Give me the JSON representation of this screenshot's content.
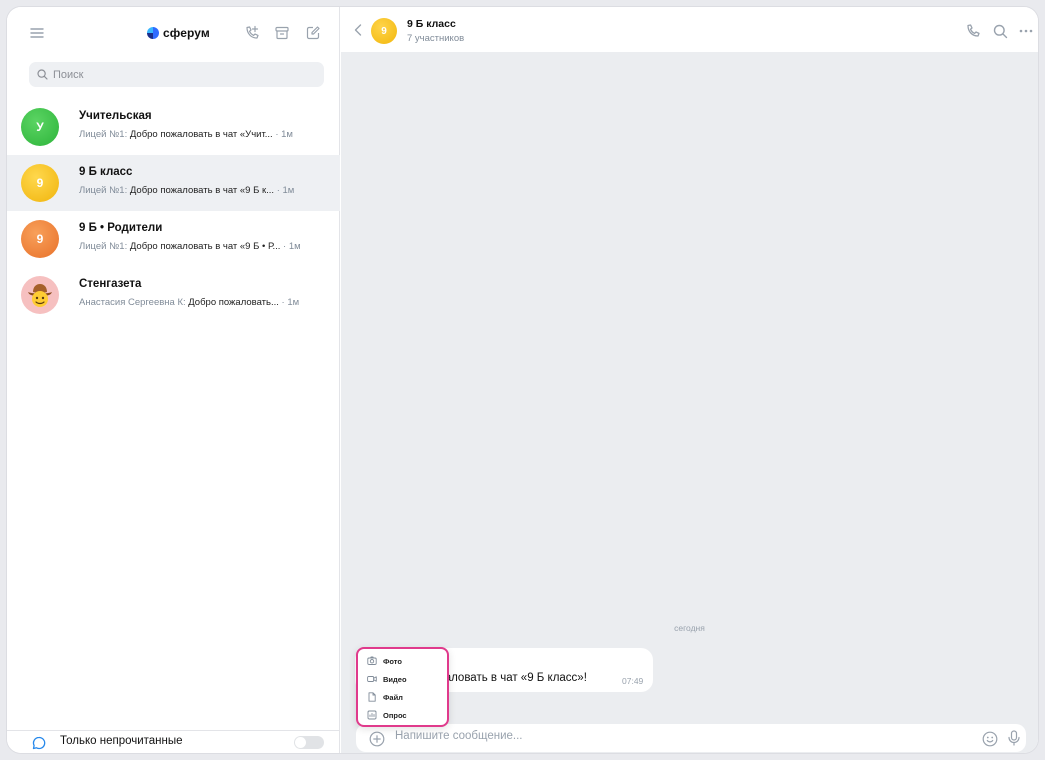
{
  "sidebar": {
    "brand": "сферум",
    "search": {
      "placeholder": "Поиск"
    },
    "chats": [
      {
        "name": "Учительская",
        "avatar_letter": "У",
        "avatar_color": "#3ec84a",
        "sender": "Лицей №1:",
        "message": "Добро пожаловать в чат «Учит...",
        "time": "· 1м"
      },
      {
        "name": "9 Б класс",
        "avatar_letter": "9",
        "avatar_color": "#f4c01c",
        "sender": "Лицей №1:",
        "message": "Добро пожаловать в чат «9 Б к...",
        "time": "· 1м"
      },
      {
        "name": "9 Б • Родители",
        "avatar_letter": "9",
        "avatar_color": "#f0853a",
        "sender": "Лицей №1:",
        "message": "Добро пожаловать в чат «9 Б • Р...",
        "time": "· 1м"
      },
      {
        "name": "Стенгазета",
        "avatar_letter": "",
        "avatar_color": "#f6b8b8",
        "sender": "Анастасия Сергеевна К:",
        "message": "Добро пожаловать...",
        "time": "· 1м"
      }
    ],
    "footer": {
      "unread_only_label": "Только непрочитанные",
      "unread_only_enabled": false
    }
  },
  "chat": {
    "header": {
      "avatar_letter": "9",
      "title": "9 Б класс",
      "subtitle": "7 участников"
    },
    "date_separator": "сегодня",
    "message": {
      "text": "жаловать в чат «9 Б класс»!",
      "time": "07:49"
    },
    "composer": {
      "placeholder": "Напишите сообщение..."
    },
    "attach_menu": [
      {
        "label": "Фото",
        "icon": "camera-icon"
      },
      {
        "label": "Видео",
        "icon": "video-icon"
      },
      {
        "label": "Файл",
        "icon": "file-icon"
      },
      {
        "label": "Опрос",
        "icon": "poll-icon"
      }
    ]
  },
  "colors": {
    "accent": "#2688eb",
    "highlight_border": "#e03a8c",
    "background": "#ebedf0"
  }
}
